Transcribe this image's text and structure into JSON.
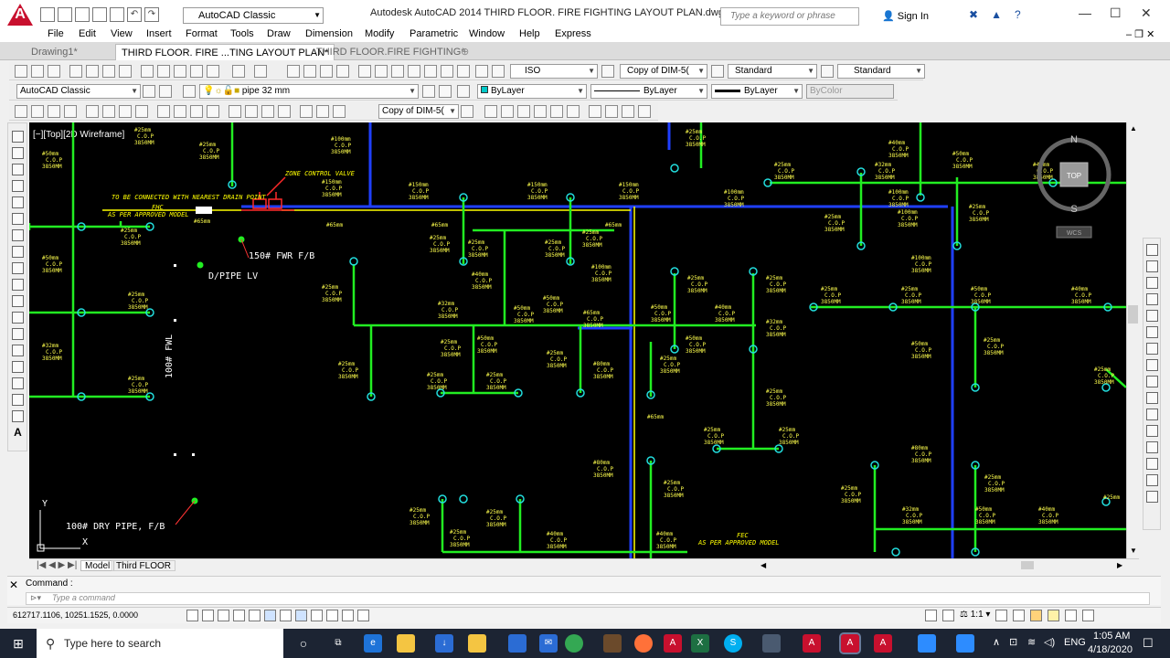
{
  "titlebar": {
    "app_title": "Autodesk AutoCAD 2014    THIRD FLOOR. FIRE FIGHTING  LAYOUT PLAN.dwg",
    "workspace": "AutoCAD Classic",
    "search_placeholder": "Type a keyword or phrase",
    "sign_in": "Sign In"
  },
  "menu": [
    "File",
    "Edit",
    "View",
    "Insert",
    "Format",
    "Tools",
    "Draw",
    "Dimension",
    "Modify",
    "Parametric",
    "Window",
    "Help",
    "Express"
  ],
  "file_tabs": [
    "Drawing1*",
    "THIRD FLOOR. FIRE ...TING  LAYOUT PLAN*",
    "THIRD FLOOR.FIRE FIGHTING*"
  ],
  "styles": {
    "text_style": "ISO",
    "dim_style": "Copy of DIM-5(",
    "table_style": "Standard",
    "mleader_style": "Standard"
  },
  "layers": {
    "workspace": "AutoCAD Classic",
    "current_layer": "pipe 32 mm",
    "color": "ByLayer",
    "linetype": "ByLayer",
    "lineweight": "ByLayer",
    "plot_style": "ByColor",
    "dim_style_dim": "Copy of DIM-5("
  },
  "viewport": {
    "label": "[−][Top][2D Wireframe]",
    "compass_n": "N",
    "compass_s": "S",
    "view_top": "TOP",
    "wcs": "WCS",
    "ucs_y": "Y",
    "ucs_x": "X"
  },
  "drawing_labels": {
    "drain": "TO BE CONNECTED WITH NEAREST DRAIN POINT",
    "zone": "ZONE CONTROL VALVE",
    "fhc_tag": "FHC",
    "approved_1": "AS PER APPROVED MODEL",
    "fwr": "150# FWR F/B",
    "dpipe": "D/PIPE LV",
    "fwl": "100# FWL",
    "dry_pipe": "100# DRY PIPE, F/B",
    "fec_tag": "FEC",
    "approved_2": "AS PER APPROVED MODEL"
  },
  "pipe_tags": [
    "#25mm",
    "C.O.P",
    "3850MM",
    "#40mm",
    "#50mm",
    "#32mm",
    "#65mm",
    "#80mm",
    "#100mm",
    "#150mm"
  ],
  "layout_tabs": [
    "Model",
    "Third FLOOR"
  ],
  "command": {
    "label": "Command :",
    "placeholder": "Type  a  command"
  },
  "status": {
    "coords": "612717.1106, 10251.1525, 0.0000",
    "scale": "1:1"
  },
  "taskbar": {
    "search": "Type here to search",
    "lang": "ENG",
    "time": "1:05 AM",
    "date": "4/18/2020"
  }
}
